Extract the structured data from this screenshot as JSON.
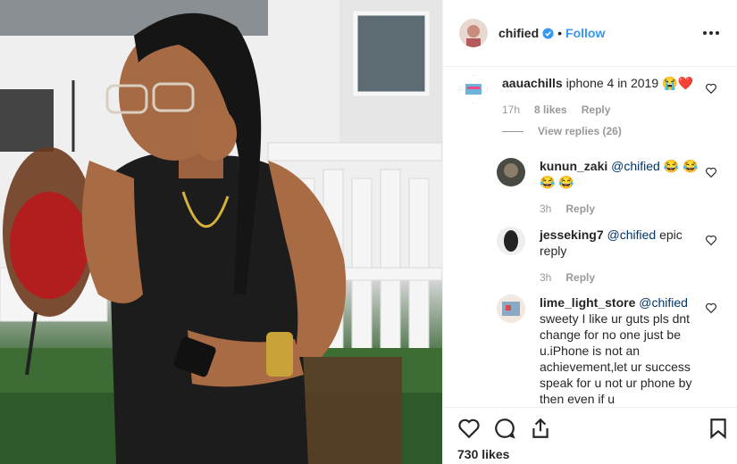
{
  "post": {
    "username": "chified",
    "follow_label": "Follow",
    "dot": "•",
    "likes": "730 likes"
  },
  "comments": [
    {
      "username": "aauachills",
      "text": "iphone 4 in 2019",
      "emoji": "😭❤️",
      "time": "17h",
      "likes": "8 likes",
      "reply": "Reply",
      "view_replies": "View replies (26)"
    },
    {
      "username": "kunun_zaki",
      "mention": "@chified",
      "text": "😂 😂 😂 😂",
      "time": "3h",
      "reply": "Reply"
    },
    {
      "username": "jesseking7",
      "mention": "@chified",
      "text": "epic reply",
      "time": "3h",
      "reply": "Reply"
    },
    {
      "username": "lime_light_store",
      "mention": "@chified",
      "text": "sweety I like ur guts pls dnt change for no one just be u.iPhone is not an achievement,let ur success speak for u not ur phone by then even if u"
    }
  ],
  "icons": {
    "like": "heart-icon",
    "comment": "comment-icon",
    "share": "share-icon",
    "save": "bookmark-icon",
    "more": "more-icon",
    "verified": "verified-badge-icon"
  },
  "colors": {
    "accent": "#3897f0",
    "text": "#262626",
    "muted": "#999999",
    "border": "#efefef"
  }
}
